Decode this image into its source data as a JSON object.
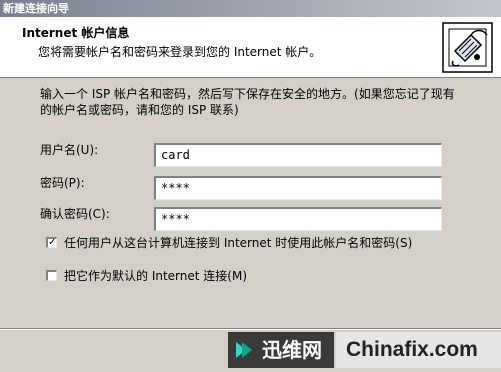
{
  "window": {
    "title": "新建连接向导"
  },
  "header": {
    "title": "Internet 帐户信息",
    "subtitle": "您将需要帐户名和密码来登录到您的 Internet 帐户。",
    "icon": "modem-connection-icon"
  },
  "intro": {
    "line1": "输入一个 ISP 帐户名和密码，然后写下保存在安全的地方。(如果您忘记了现有",
    "line2": "的帐户名或密码，请和您的 ISP 联系)"
  },
  "form": {
    "username_label": "用户名(U):",
    "username_value": "card",
    "password_label": "密码(P):",
    "password_value": "****",
    "confirm_label": "确认密码(C):",
    "confirm_value": "****",
    "use_for_all_label": "任何用户从这台计算机连接到 Internet 时使用此帐户名和密码(S)",
    "use_for_all_checked": true,
    "default_connection_label": "把它作为默认的 Internet 连接(M)",
    "default_connection_checked": false
  },
  "watermark": {
    "brand1": "迅维网",
    "brand2": "Chinafix.com"
  }
}
